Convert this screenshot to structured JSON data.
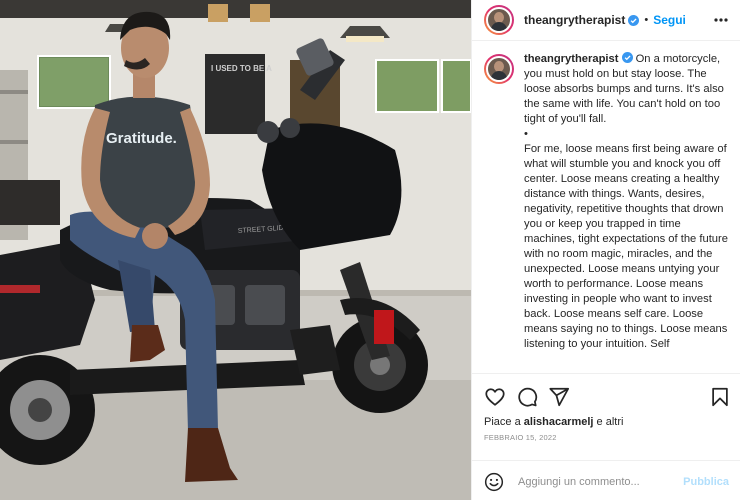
{
  "post": {
    "username": "theangrytherapist",
    "verified": true,
    "follow_label": "Segui",
    "more_icon": "more-horizontal-icon",
    "caption_lines": [
      "On a motorcycle, you must hold on but stay loose. The loose absorbs bumps and turns. It's also the same with life. You can't hold on too tight of you'll fall.",
      "•",
      "For me, loose means first being aware of what will stumble you and knock you off center. Loose means creating a healthy distance with things. Wants, desires, negativity, repetitive thoughts that drown you or keep you trapped in time machines, tight expectations of the future with no room magic, miracles, and the unexpected. Loose means untying your worth to performance. Loose means investing in people who want to invest back. Loose means self care. Loose means saying no to things. Loose means listening to your intuition. Self"
    ],
    "likes_prefix": "Piace a",
    "likes_user": "alishacarmelj",
    "likes_suffix": "e altri",
    "date": "FEBBRAIO 15, 2022",
    "comment_placeholder": "Aggiungi un commento...",
    "publish_label": "Pubblica",
    "colors": {
      "accent": "#0095f6",
      "publish_disabled": "#b2dffc",
      "verified": "#3897f0"
    }
  },
  "photo": {
    "shirt_text": "Gratitude.",
    "sign_text": "I USED TO BE A",
    "bike_text": "STREET GLIDE"
  }
}
